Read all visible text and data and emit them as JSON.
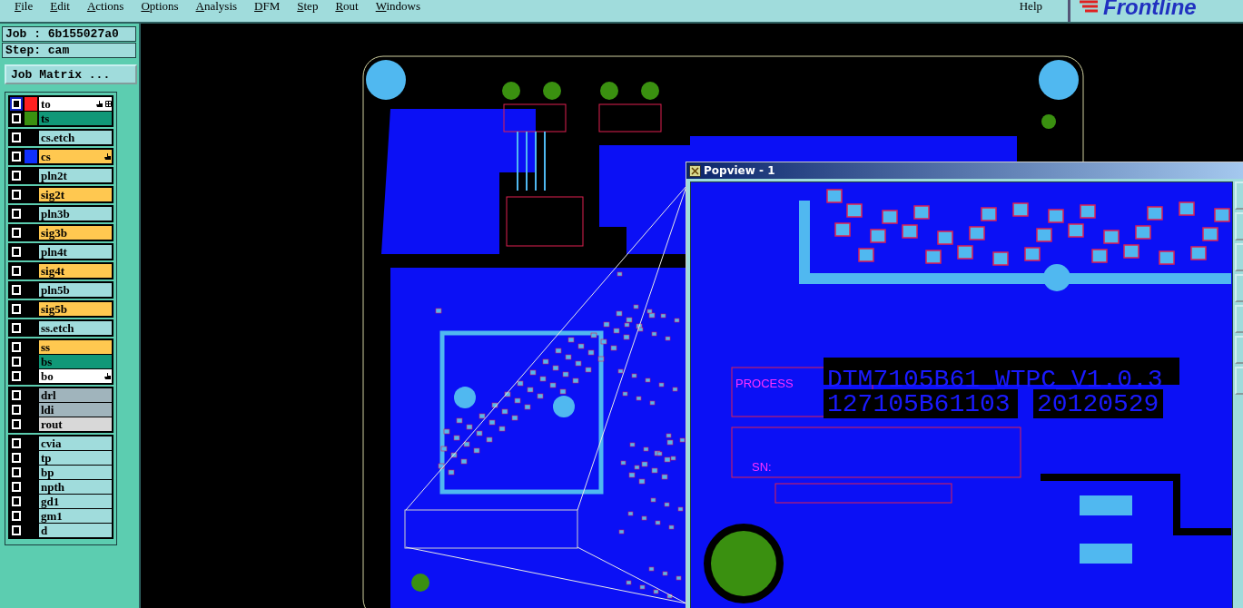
{
  "menu": {
    "items": [
      "File",
      "Edit",
      "Actions",
      "Options",
      "Analysis",
      "DFM",
      "Step",
      "Rout",
      "Windows"
    ],
    "help": "Help",
    "logo": "Frontline"
  },
  "job": {
    "job_label": "Job : 6b155027a0",
    "step_label": "Step: cam",
    "matrix_button": "Job Matrix ..."
  },
  "layer_groups": [
    {
      "layers": [
        {
          "name": "to",
          "kind": "active",
          "color": "#ff2020",
          "selected": true,
          "hand": true,
          "grid": true
        },
        {
          "name": "ts",
          "kind": "mask",
          "color": "#3a9010",
          "selected": false
        }
      ]
    },
    {
      "layers": [
        {
          "name": "cs.etch",
          "kind": "plane",
          "selected": false
        }
      ]
    },
    {
      "layers": [
        {
          "name": "cs",
          "kind": "signal",
          "color": "#1030ff",
          "selected": false,
          "hand": true
        }
      ]
    },
    {
      "layers": [
        {
          "name": "pln2t",
          "kind": "plane",
          "selected": false
        }
      ]
    },
    {
      "layers": [
        {
          "name": "sig2t",
          "kind": "signal",
          "selected": false
        }
      ]
    },
    {
      "layers": [
        {
          "name": "pln3b",
          "kind": "plane",
          "selected": false
        }
      ]
    },
    {
      "layers": [
        {
          "name": "sig3b",
          "kind": "signal",
          "selected": false
        }
      ]
    },
    {
      "layers": [
        {
          "name": "pln4t",
          "kind": "plane",
          "selected": false
        }
      ]
    },
    {
      "layers": [
        {
          "name": "sig4t",
          "kind": "signal",
          "selected": false
        }
      ]
    },
    {
      "layers": [
        {
          "name": "pln5b",
          "kind": "plane",
          "selected": false
        }
      ]
    },
    {
      "layers": [
        {
          "name": "sig5b",
          "kind": "signal",
          "selected": false
        }
      ]
    },
    {
      "layers": [
        {
          "name": "ss.etch",
          "kind": "plane",
          "selected": false
        }
      ]
    },
    {
      "layers": [
        {
          "name": "ss",
          "kind": "signal",
          "selected": false
        },
        {
          "name": "bs",
          "kind": "mask",
          "selected": false
        },
        {
          "name": "bo",
          "kind": "active",
          "selected": false,
          "hand": true
        }
      ]
    },
    {
      "layers": [
        {
          "name": "drl",
          "kind": "drill",
          "selected": false
        },
        {
          "name": "ldi",
          "kind": "drill",
          "selected": false
        },
        {
          "name": "rout",
          "kind": "rout",
          "selected": false
        }
      ]
    },
    {
      "layers": [
        {
          "name": "cvia",
          "kind": "plane",
          "selected": false
        },
        {
          "name": "tp",
          "kind": "plane",
          "selected": false
        },
        {
          "name": "bp",
          "kind": "plane",
          "selected": false
        },
        {
          "name": "npth",
          "kind": "plane",
          "selected": false
        },
        {
          "name": "gd1",
          "kind": "plane",
          "selected": false
        },
        {
          "name": "gm1",
          "kind": "plane",
          "selected": false
        },
        {
          "name": "d",
          "kind": "plane",
          "selected": false
        }
      ]
    }
  ],
  "popview": {
    "title": "Popview - 1",
    "board_name": "DTM7105B61_WTPC_V1.0.3",
    "part_number": "127105B61103",
    "date": "20120529",
    "process_label": "PROCESS",
    "sn_label": "SN:"
  }
}
